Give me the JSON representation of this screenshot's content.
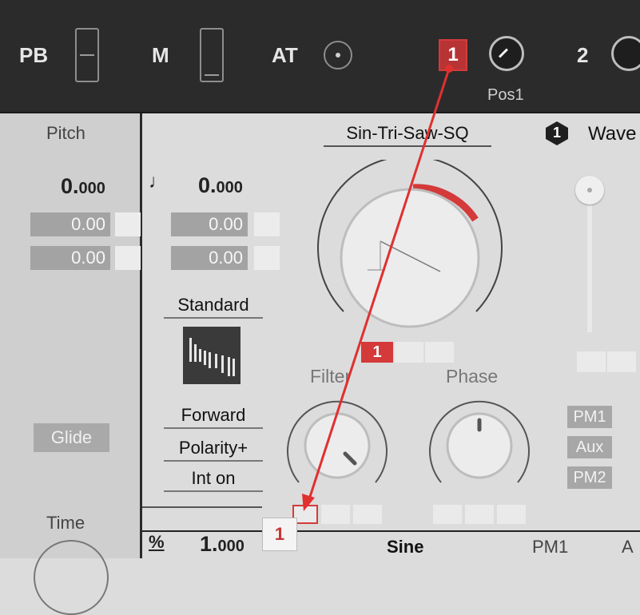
{
  "topbar": {
    "pb_label": "PB",
    "m_label": "M",
    "at_label": "AT",
    "macro1_badge": "1",
    "macro1_caption": "Pos1",
    "macro2_number": "2"
  },
  "left_panel": {
    "pitch_label": "Pitch",
    "pitch_value_main": "0.",
    "pitch_value_sub": "000",
    "mod_values": [
      "0.00",
      "0.00"
    ],
    "glide_label": "Glide",
    "time_label": "Time"
  },
  "osc": {
    "note_icon": "♩",
    "value_main": "0.",
    "value_sub": "000",
    "mod_values": [
      "0.00",
      "0.00"
    ],
    "mode_label": "Standard",
    "direction_label": "Forward",
    "polarity_label": "Polarity+",
    "interp_label": "Int on",
    "wave_name": "Sin-Tri-Saw-SQ",
    "wave_index_badge": "1",
    "wave_header": "Wave",
    "wave_mod_badge": "1",
    "filter_label": "Filter",
    "phase_label": "Phase",
    "mod_tags": [
      "PM1",
      "Aux",
      "PM2"
    ]
  },
  "bottom": {
    "percent_icon": "%",
    "value_main": "1.",
    "value_sub": "000",
    "badge": "1",
    "wave_name": "Sine",
    "pm_label": "PM1",
    "cut_label": "A"
  },
  "colors": {
    "accent_red": "#d43a3a",
    "topbar_bg": "#2b2b2b",
    "panel_bg": "#dcdcdc"
  }
}
